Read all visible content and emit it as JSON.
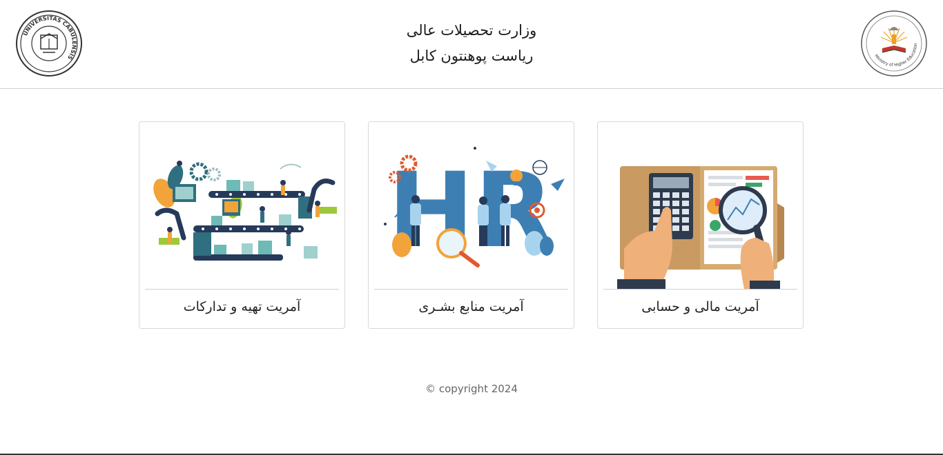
{
  "header": {
    "title_line1": "وزارت تحصیلات عالی",
    "title_line2": "ریاست پوهنتون کابل",
    "left_logo": {
      "icon": "university-seal-icon",
      "text": "UNIVERSITAS CABULENSIS"
    },
    "right_logo": {
      "icon": "ministry-emblem-icon",
      "text": "Ministry of Higher Education"
    }
  },
  "cards": [
    {
      "label": "آمریت تهیه و تدارکات",
      "icon": "procurement-illustration-icon"
    },
    {
      "label": "آمریت منابع بشـری",
      "icon": "hr-illustration-icon",
      "image_text": "HR"
    },
    {
      "label": "آمریت مالی و حسابی",
      "icon": "finance-illustration-icon"
    }
  ],
  "footer": {
    "copyright": "© copyright 2024"
  },
  "colors": {
    "border": "#d8d8d8",
    "header_border": "#cfcfcf",
    "accent_blue": "#3d7fb3",
    "accent_orange": "#f2a33a",
    "folder_brown": "#c99a62"
  }
}
